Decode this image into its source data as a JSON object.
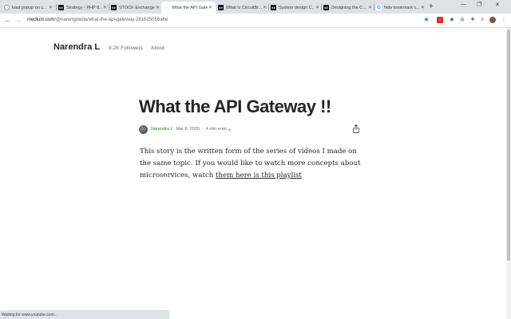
{
  "tabs": [
    {
      "title": "load popup on c...",
      "icon": "blank-page-icon"
    },
    {
      "title": "Strategy - PHP 8...",
      "icon": "medium-icon"
    },
    {
      "title": "STOCK Exchange...",
      "icon": "medium-icon"
    },
    {
      "title": "What the API Gate...",
      "icon": "loading-icon",
      "active": true
    },
    {
      "title": "What is CircuitBr...",
      "icon": "medium-icon"
    },
    {
      "title": "System design C...",
      "icon": "medium-icon"
    },
    {
      "title": "Designing the C...",
      "icon": "medium-icon"
    },
    {
      "title": "hide bookmark c...",
      "icon": "google-icon"
    }
  ],
  "toolbar": {
    "url_host": "medium.com",
    "url_path": "/@narengowda/what-the-api-gateway-281625056a6e"
  },
  "site": {
    "brand": "Narendra L",
    "followers": "8.2K Followers",
    "about": "About"
  },
  "article": {
    "title": "What the API Gateway !!",
    "author": "Narendra L",
    "date": "Mar 8, 2020",
    "read_time": "4 min read",
    "body_text": "This story is the written form of the series of videos I made on the same topic. If you would like to watch more concepts about microservices, watch ",
    "link_text": "them here is this playlist"
  },
  "status_text": "Waiting for www.youtube.com..."
}
